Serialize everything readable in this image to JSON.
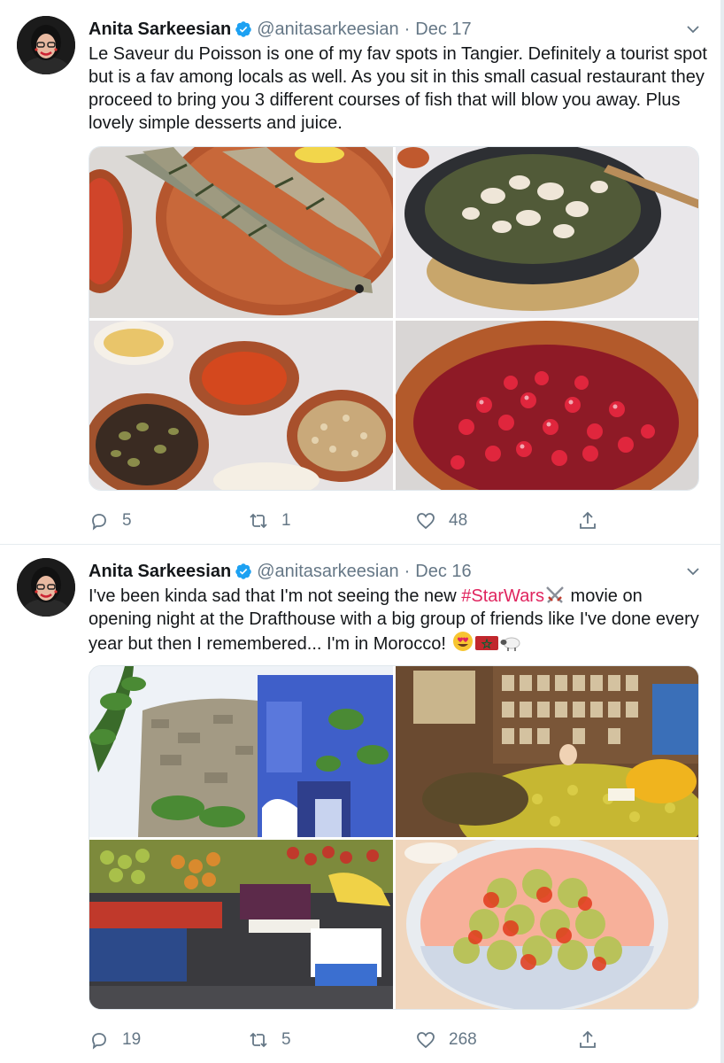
{
  "colors": {
    "hashtag": "#e0245e",
    "meta": "#657786",
    "verified": "#1da1f2"
  },
  "tweets": [
    {
      "author": "Anita Sarkeesian",
      "handle": "@anitasarkeesian",
      "separator": "·",
      "date": "Dec 17",
      "text": "Le Saveur du Poisson is one of my fav spots in Tangier. Definitely a tourist spot but is a fav among locals as well. As you sit in this small casual restaurant they proceed to bring you 3 different courses of fish that will blow you away. Plus lovely simple desserts and juice.",
      "images": [
        "grilled-fish-photo",
        "fish-tagine-photo",
        "olives-nuts-dips-photo",
        "pomegranate-dessert-photo"
      ],
      "replies": "5",
      "retweets": "1",
      "likes": "48"
    },
    {
      "author": "Anita Sarkeesian",
      "handle": "@anitasarkeesian",
      "separator": "·",
      "date": "Dec 16",
      "text_part1": "I've been kinda sad that I'm not seeing the new ",
      "hashtag": "#StarWars",
      "text_part2": " movie on opening night at the Drafthouse with a big group of friends like I've done every year but then I remembered... I'm in Morocco! ",
      "emojis": [
        "crossed-swords-emoji",
        "heart-eyes-emoji",
        "morocco-flag-emoji",
        "sheep-emoji"
      ],
      "images": [
        "blue-courtyard-photo",
        "spice-shop-olives-photo",
        "fruit-market-photo",
        "olives-bowl-photo"
      ],
      "replies": "19",
      "retweets": "5",
      "likes": "268"
    }
  ]
}
